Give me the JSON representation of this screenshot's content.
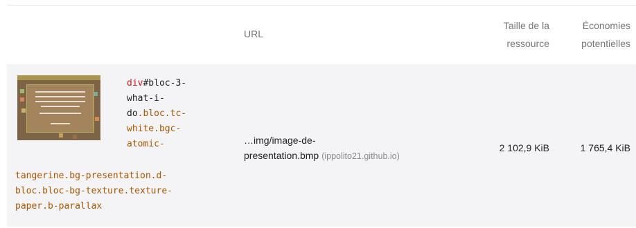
{
  "table": {
    "headers": {
      "url": "URL",
      "resource_size_line1": "Taille de la",
      "resource_size_line2": "ressource",
      "savings_line1": "Économies",
      "savings_line2": "potentielles"
    },
    "row": {
      "element_snippet": {
        "tag": "div",
        "id": "#bloc-3-",
        "lines_right": [
          "what-i-",
          "do",
          ".bloc.tc-",
          "white.bgc-",
          "atomic-"
        ],
        "lines_full": [
          "tangerine.bg-presentation.d-",
          "bloc.bloc-bg-texture.texture-",
          "paper.b-parallax"
        ]
      },
      "url_line1": "…img/image-de-",
      "url_line2": "presentation.bmp",
      "host": "(ippolito21.github.io)",
      "resource_size": "2 102,9 KiB",
      "potential_savings": "1 765,4 KiB"
    }
  },
  "colors": {
    "row_background": "#f4f4f6",
    "header_text": "#757575",
    "tag_color": "#c5221f",
    "class_color": "#aa5500"
  }
}
